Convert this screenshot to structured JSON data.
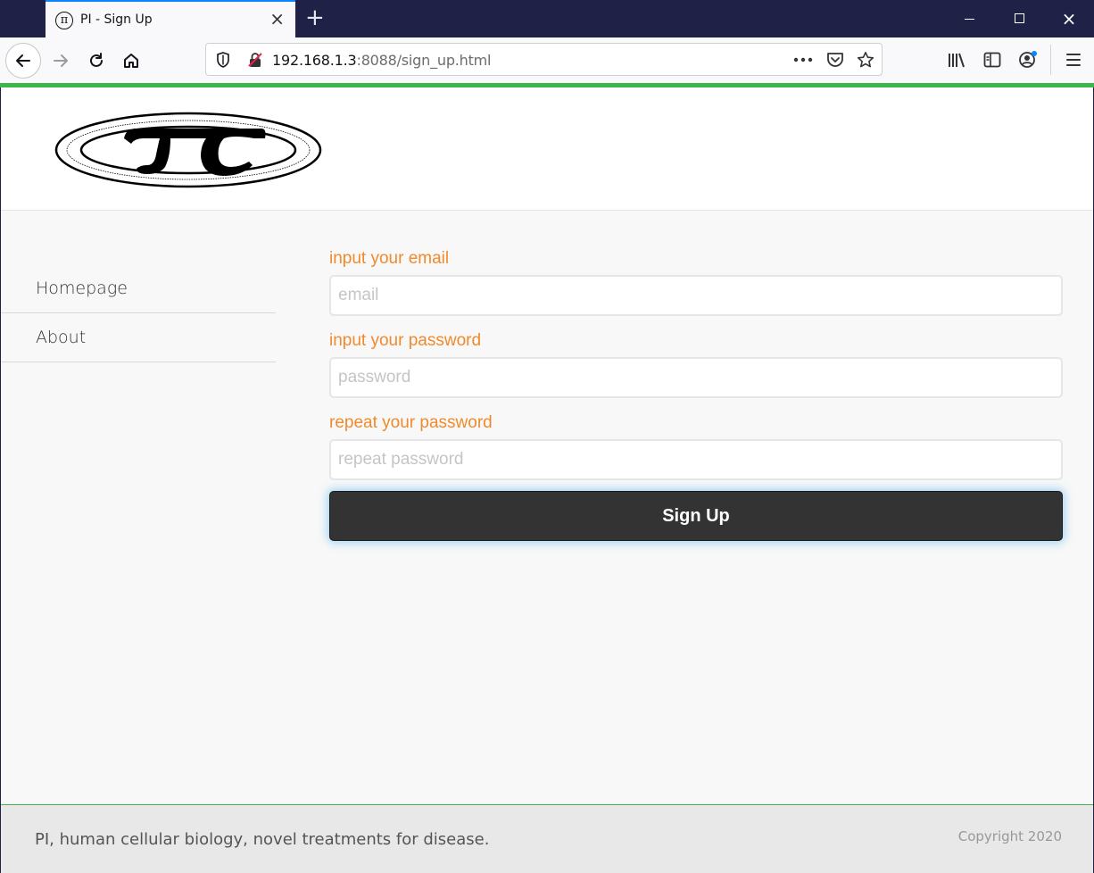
{
  "browser": {
    "tab_title": "PI - Sign Up",
    "tab_favicon": "π",
    "url_host": "192.168.1.3",
    "url_rest": ":8088/sign_up.html",
    "accent_color": "#0a84ff",
    "load_bar_color": "#3cb54a"
  },
  "nav": {
    "items": [
      {
        "label": "Homepage"
      },
      {
        "label": "About"
      }
    ]
  },
  "form": {
    "email_label": "input your email",
    "email_placeholder": "email",
    "password_label": "input your password",
    "password_placeholder": "password",
    "repeat_label": "repeat your password",
    "repeat_placeholder": "repeat password",
    "submit_label": "Sign Up",
    "label_color": "#f08a2c"
  },
  "footer": {
    "tagline": "PI, human cellular biology, novel treatments for disease.",
    "copyright": "Copyright 2020"
  }
}
